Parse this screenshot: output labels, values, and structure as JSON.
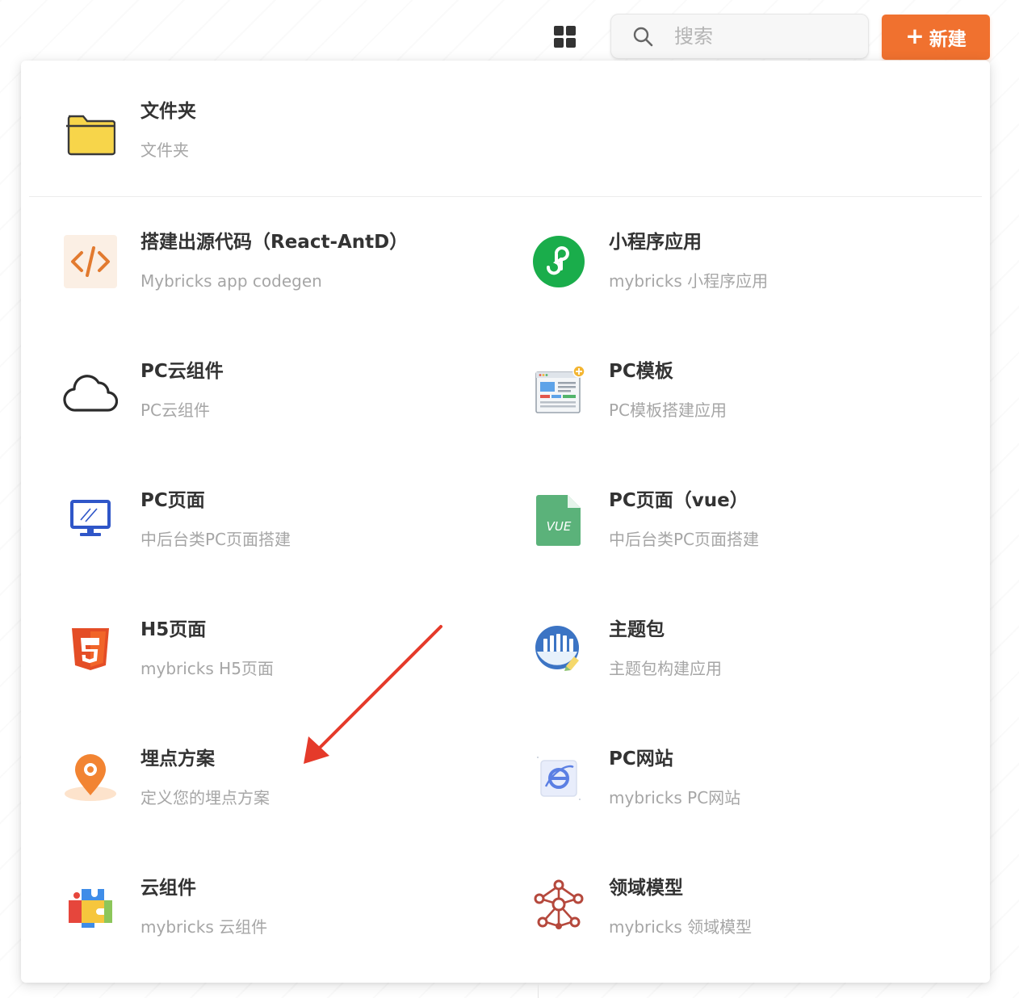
{
  "toolbar": {
    "search_placeholder": "搜索",
    "new_label": "新建",
    "new_plus": "+"
  },
  "folder": {
    "title": "文件夹",
    "desc": "文件夹",
    "icon": "folder-icon"
  },
  "items": [
    {
      "title": "搭建出源代码（React-AntD）",
      "desc": "Mybricks app codegen",
      "icon": "code-icon"
    },
    {
      "title": "小程序应用",
      "desc": "mybricks 小程序应用",
      "icon": "mini-program-icon"
    },
    {
      "title": "PC云组件",
      "desc": "PC云组件",
      "icon": "cloud-icon"
    },
    {
      "title": "PC模板",
      "desc": "PC模板搭建应用",
      "icon": "template-icon"
    },
    {
      "title": "PC页面",
      "desc": "中后台类PC页面搭建",
      "icon": "monitor-icon"
    },
    {
      "title": "PC页面（vue）",
      "desc": "中后台类PC页面搭建",
      "icon": "vue-file-icon"
    },
    {
      "title": "H5页面",
      "desc": "mybricks H5页面",
      "icon": "html5-icon"
    },
    {
      "title": "主题包",
      "desc": "主题包构建应用",
      "icon": "theme-package-icon"
    },
    {
      "title": "埋点方案",
      "desc": "定义您的埋点方案",
      "icon": "location-pin-icon"
    },
    {
      "title": "PC网站",
      "desc": "mybricks PC网站",
      "icon": "website-icon"
    },
    {
      "title": "云组件",
      "desc": "mybricks 云组件",
      "icon": "puzzle-icon"
    },
    {
      "title": "领域模型",
      "desc": "mybricks 领域模型",
      "icon": "domain-model-icon"
    }
  ],
  "colors": {
    "accent": "#f0712f",
    "title": "#333333",
    "desc": "#a6a6a6",
    "annotation_arrow": "#e53a2a"
  }
}
